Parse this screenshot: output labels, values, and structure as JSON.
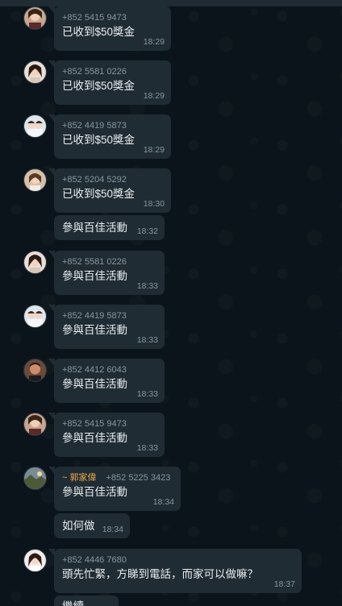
{
  "messages": [
    {
      "sender": "+852 5415 9473",
      "nick": "",
      "text": "已收到$50獎金",
      "time": "18:29",
      "avatar": "avatar-woman-1"
    },
    {
      "sender": "+852 5581 0226",
      "nick": "",
      "text": "已收到$50獎金",
      "time": "18:29",
      "avatar": "avatar-woman-2"
    },
    {
      "sender": "+852 4419 5873",
      "nick": "",
      "text": "已收到$50獎金",
      "time": "18:29",
      "avatar": "avatar-couple"
    },
    {
      "sender": "+852 5204 5292",
      "nick": "",
      "text": "已收到$50獎金",
      "time": "18:30",
      "avatar": "avatar-woman-3"
    },
    {
      "sender": "",
      "nick": "",
      "text": "參與百佳活動",
      "time": "18:32",
      "avatar": ""
    },
    {
      "sender": "+852 5581 0226",
      "nick": "",
      "text": "參與百佳活動",
      "time": "18:33",
      "avatar": "avatar-woman-2"
    },
    {
      "sender": "+852 4419 5873",
      "nick": "",
      "text": "參與百佳活動",
      "time": "18:33",
      "avatar": "avatar-couple"
    },
    {
      "sender": "+852 4412 6043",
      "nick": "",
      "text": "參與百佳活動",
      "time": "18:33",
      "avatar": "avatar-man"
    },
    {
      "sender": "+852 5415 9473",
      "nick": "",
      "text": "參與百佳活動",
      "time": "18:33",
      "avatar": "avatar-woman-1"
    },
    {
      "sender": "+852 5225 3423",
      "nick": "~ 郭家偉",
      "text": "參與百佳活動",
      "time": "18:34",
      "avatar": "avatar-landscape"
    },
    {
      "sender": "",
      "nick": "",
      "text": "如何做",
      "time": "18:34",
      "avatar": ""
    },
    {
      "sender": "+852 4446 7680",
      "nick": "",
      "text": "頭先忙緊，方睇到電話，而家可以做嘛？",
      "time": "18:37",
      "avatar": "avatar-woman-4"
    },
    {
      "sender": "",
      "nick": "",
      "text": "繼續",
      "time": "",
      "avatar": ""
    }
  ],
  "colors": {
    "bubble": "#202c33",
    "background": "#0b141a",
    "meta": "#8696a0",
    "nick": "#e9a94f",
    "text": "#e9edef"
  }
}
